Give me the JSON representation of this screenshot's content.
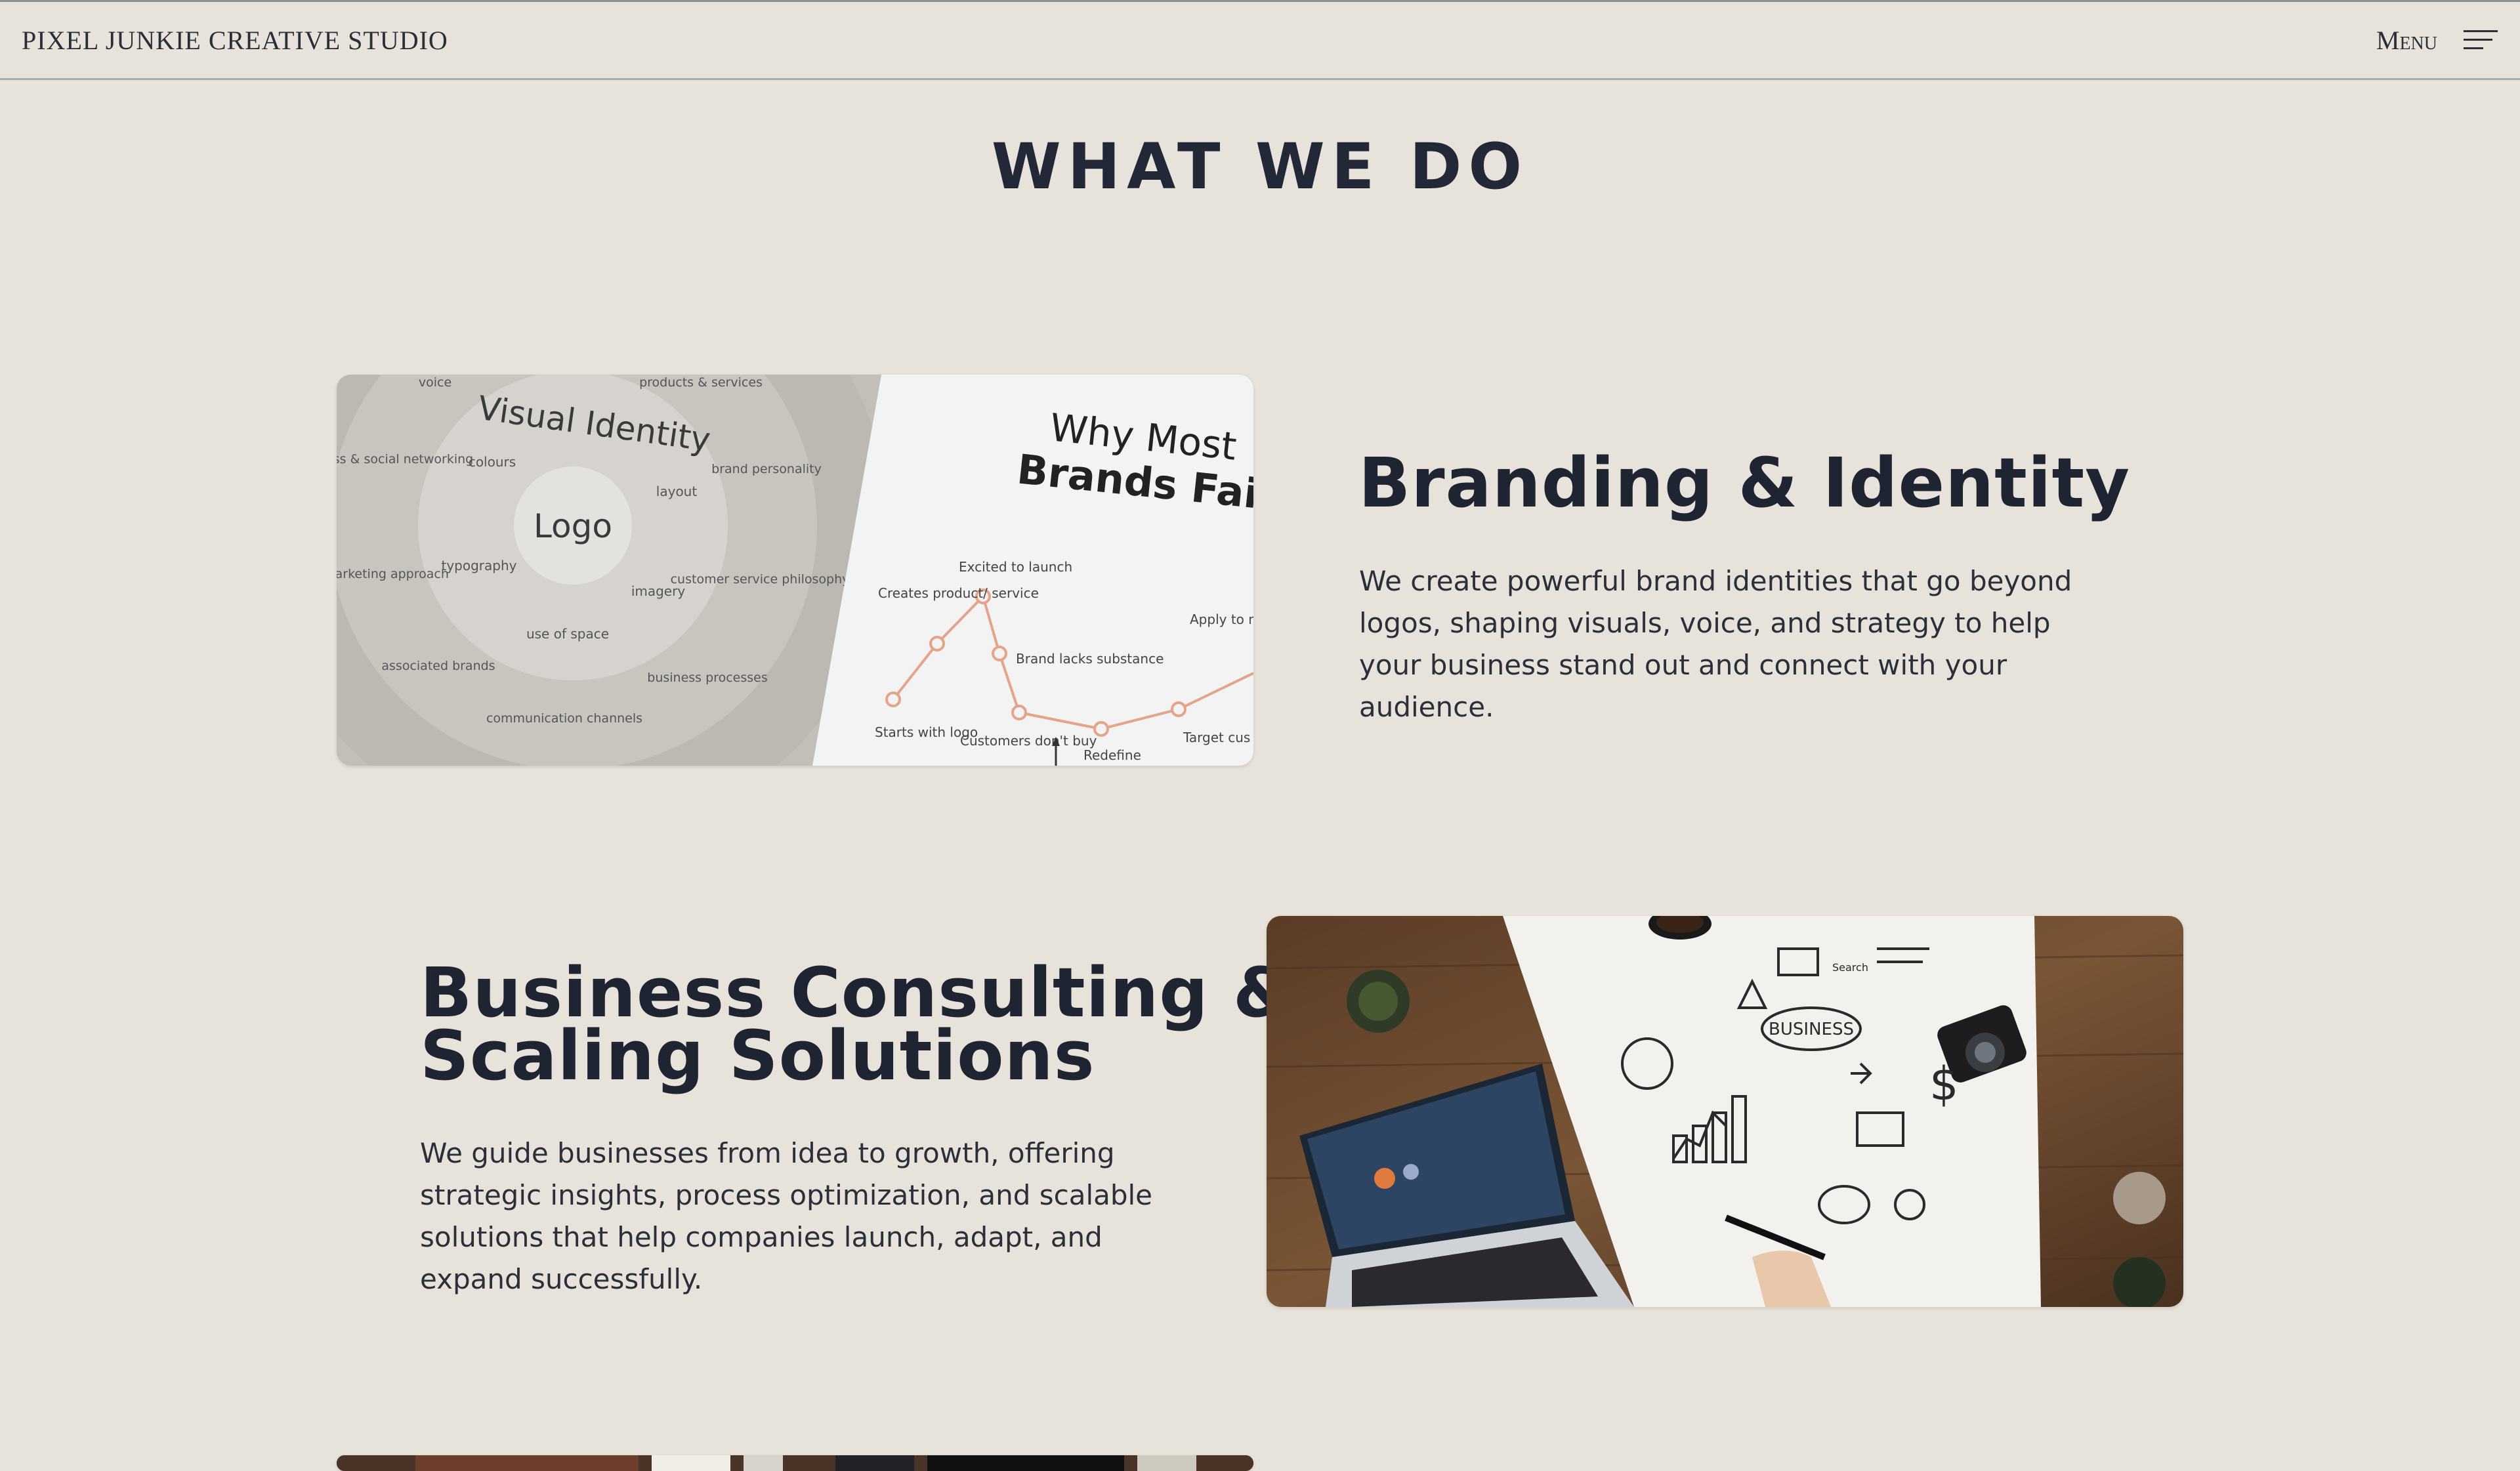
{
  "header": {
    "brand": "PIXEL JUNKIE CREATIVE STUDIO",
    "menu_label": "Menu",
    "menu_icon": "hamburger-icon"
  },
  "section": {
    "title": "WHAT WE DO"
  },
  "services": [
    {
      "title": "Branding & Identity",
      "description": "We create powerful brand identities that go beyond logos, shaping visuals, voice, and strategy to help your business stand out and connect with your audience.",
      "image": {
        "wheel_title": "Visual Identity",
        "wheel_center": "Logo",
        "inner_ring": [
          "colours",
          "layout",
          "imagery",
          "use of space",
          "typography"
        ],
        "outer_ring": [
          "voice",
          "products & services",
          "brand personality",
          "customer service philosophy",
          "business processes",
          "communication channels",
          "associated brands",
          "marketing approach",
          "business & social networking"
        ],
        "panel_title_line1": "Why Most",
        "panel_title_line2": "Brands Fail",
        "curve_labels": [
          "Starts with logo",
          "Creates product/ service",
          "Excited to launch",
          "Brand lacks substance",
          "Customers don't buy",
          "Redefine",
          "Target cus emotions",
          "Apply to marketing channels"
        ]
      }
    },
    {
      "title_line1": "Business Consulting &",
      "title_line2": "Scaling Solutions",
      "description": "We guide businesses from idea to growth, offering strategic insights, process optimization, and scalable solutions that help companies launch, adapt, and expand successfully.",
      "image": {
        "sketch_label": "BUSINESS",
        "search_label": "Search"
      }
    }
  ],
  "colors": {
    "background": "#e7e3da",
    "text": "#1f2433",
    "wood": "#6b4a30"
  }
}
